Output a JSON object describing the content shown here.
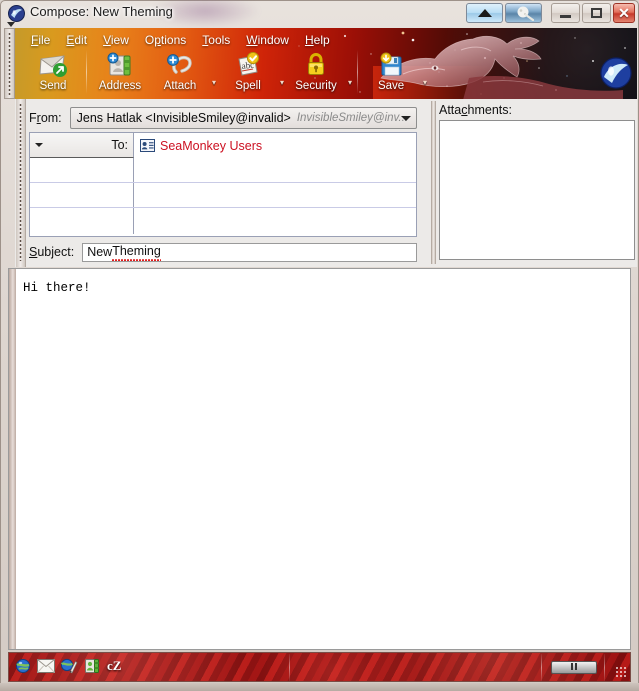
{
  "window": {
    "title": "Compose: New Theming",
    "app_icon": "seamonkey-icon",
    "controls": {
      "extra_up_label": "▲",
      "extra_moon_label": "moon-icon",
      "minimize_label": "—",
      "maximize_label": "□",
      "close_label": "✕"
    }
  },
  "menubar": {
    "items": [
      {
        "label": "File",
        "accel": "F"
      },
      {
        "label": "Edit",
        "accel": "E"
      },
      {
        "label": "View",
        "accel": "V"
      },
      {
        "label": "Options",
        "accel": "O"
      },
      {
        "label": "Tools",
        "accel": "T"
      },
      {
        "label": "Window",
        "accel": "W"
      },
      {
        "label": "Help",
        "accel": "H"
      }
    ]
  },
  "toolbar": {
    "buttons": [
      {
        "label": "Send",
        "icon": "send-envelope-icon",
        "has_dropdown": false
      },
      {
        "label": "Address",
        "icon": "address-book-icon",
        "has_dropdown": false
      },
      {
        "label": "Attach",
        "icon": "paperclip-icon",
        "has_dropdown": true
      },
      {
        "label": "Spell",
        "icon": "spellcheck-abc-icon",
        "has_dropdown": true
      },
      {
        "label": "Security",
        "icon": "padlock-icon",
        "has_dropdown": true
      },
      {
        "label": "Save",
        "icon": "floppy-disk-icon",
        "has_dropdown": true
      }
    ]
  },
  "headers": {
    "from": {
      "label": "From:",
      "accel": "r",
      "value": "Jens Hatlak <InvisibleSmiley@invalid>",
      "identity": "InvisibleSmiley@inv...",
      "dropdown_icon": "chevron-down-icon"
    },
    "recipients": {
      "rows": [
        {
          "type": "To:",
          "value": "SeaMonkey Users",
          "icon": "address-card-icon"
        },
        {
          "type": "",
          "value": ""
        },
        {
          "type": "",
          "value": ""
        },
        {
          "type": "",
          "value": ""
        }
      ]
    },
    "subject": {
      "label": "Subject:",
      "accel": "S",
      "value_ok": "New ",
      "value_misspelled": "Theming"
    }
  },
  "attachments": {
    "label": "Attachments:",
    "accel": "c",
    "items": []
  },
  "body": {
    "text": "Hi there!"
  },
  "statusbar": {
    "icons": [
      {
        "name": "navigator-globe-icon",
        "label": ""
      },
      {
        "name": "mail-envelope-icon",
        "label": ""
      },
      {
        "name": "composer-globe-pen-icon",
        "label": ""
      },
      {
        "name": "address-book-icon",
        "label": ""
      },
      {
        "name": "chatzilla-icon",
        "label": "cZ"
      }
    ],
    "progress_label": "",
    "resize_grip": "resize-grip-icon"
  },
  "colors": {
    "recipient_text": "#cc1122",
    "theme_gold": "#d99a1e",
    "theme_red": "#9c0f06",
    "status_red": "#8e1111",
    "close_button": "#c6392a"
  }
}
